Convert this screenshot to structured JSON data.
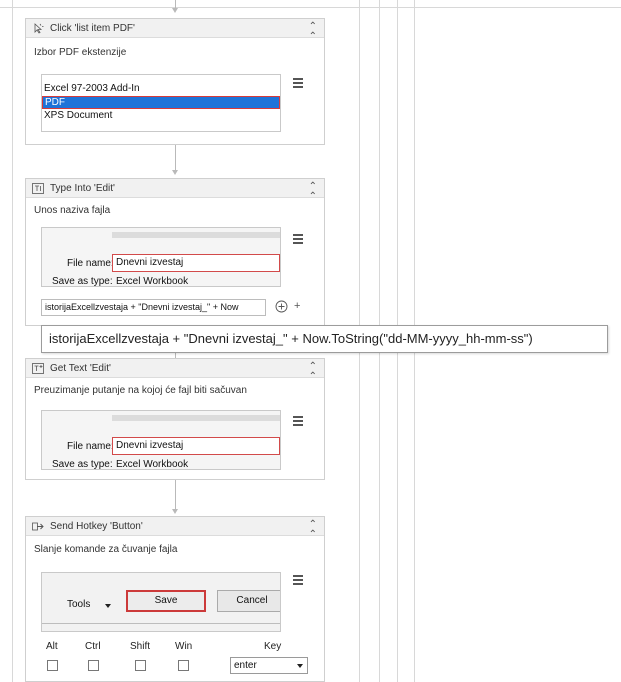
{
  "activities": [
    {
      "title": "Click 'list item  PDF'",
      "icon": "click-icon",
      "description": "Izbor PDF ekstenzije",
      "list_items": [
        "Excel 97-2003 Add-In",
        "PDF",
        "XPS Document"
      ],
      "selected_item": "PDF"
    },
    {
      "title": "Type Into 'Edit'",
      "icon": "type-into-icon",
      "description": "Unos naziva fajla",
      "file_name_label": "File name:",
      "file_name_value": "Dnevni izvestaj",
      "save_as_label": "Save as type:",
      "save_as_value": "Excel Workbook",
      "text_expression": "istorijaExcellzvestaja + \"Dnevni izvestaj_\" + Now",
      "plus_label": "+"
    },
    {
      "title": "Get Text 'Edit'",
      "icon": "get-text-icon",
      "description": "Preuzimanje putanje na kojoj će fajl biti sačuvan",
      "file_name_label": "File name:",
      "file_name_value": "Dnevni izvestaj",
      "save_as_label": "Save as type:",
      "save_as_value": "Excel Workbook"
    },
    {
      "title": "Send Hotkey 'Button'",
      "icon": "send-hotkey-icon",
      "description": "Slanje komande za čuvanje fajla",
      "tools_label": "Tools",
      "save_label": "Save",
      "cancel_label": "Cancel",
      "modifiers": [
        "Alt",
        "Ctrl",
        "Shift",
        "Win"
      ],
      "key_header": "Key",
      "key_value": "enter"
    }
  ],
  "tooltip_text": "istorijaExcellzvestaja + \"Dnevni izvestaj_\" + Now.ToString(\"dd-MM-yyyy_hh-mm-ss\")",
  "colors": {
    "selection": "#1e73d8",
    "highlight_border": "#d63a3a",
    "card_header": "#f1f1f1"
  }
}
